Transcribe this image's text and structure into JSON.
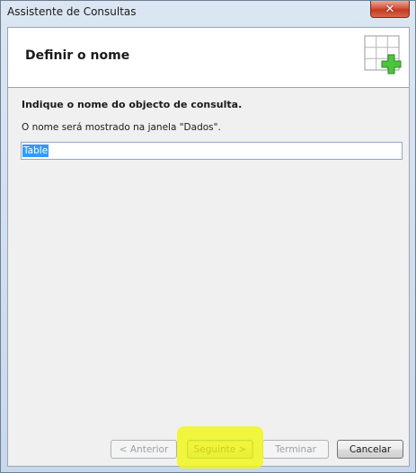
{
  "window": {
    "title": "Assistente de Consultas",
    "close_icon": "close-icon"
  },
  "header": {
    "title": "Definir o nome",
    "icon": "table-add-icon"
  },
  "content": {
    "instruction": "Indique o nome do objecto de consulta.",
    "hint": "O nome será mostrado na janela \"Dados\".",
    "name_value": "Table"
  },
  "buttons": {
    "back": "< Anterior",
    "next": "Seguinte >",
    "finish": "Terminar",
    "cancel": "Cancelar"
  },
  "colors": {
    "selection": "#3399ff",
    "highlight": "#f0f514",
    "icon_plus": "#3cb832"
  }
}
